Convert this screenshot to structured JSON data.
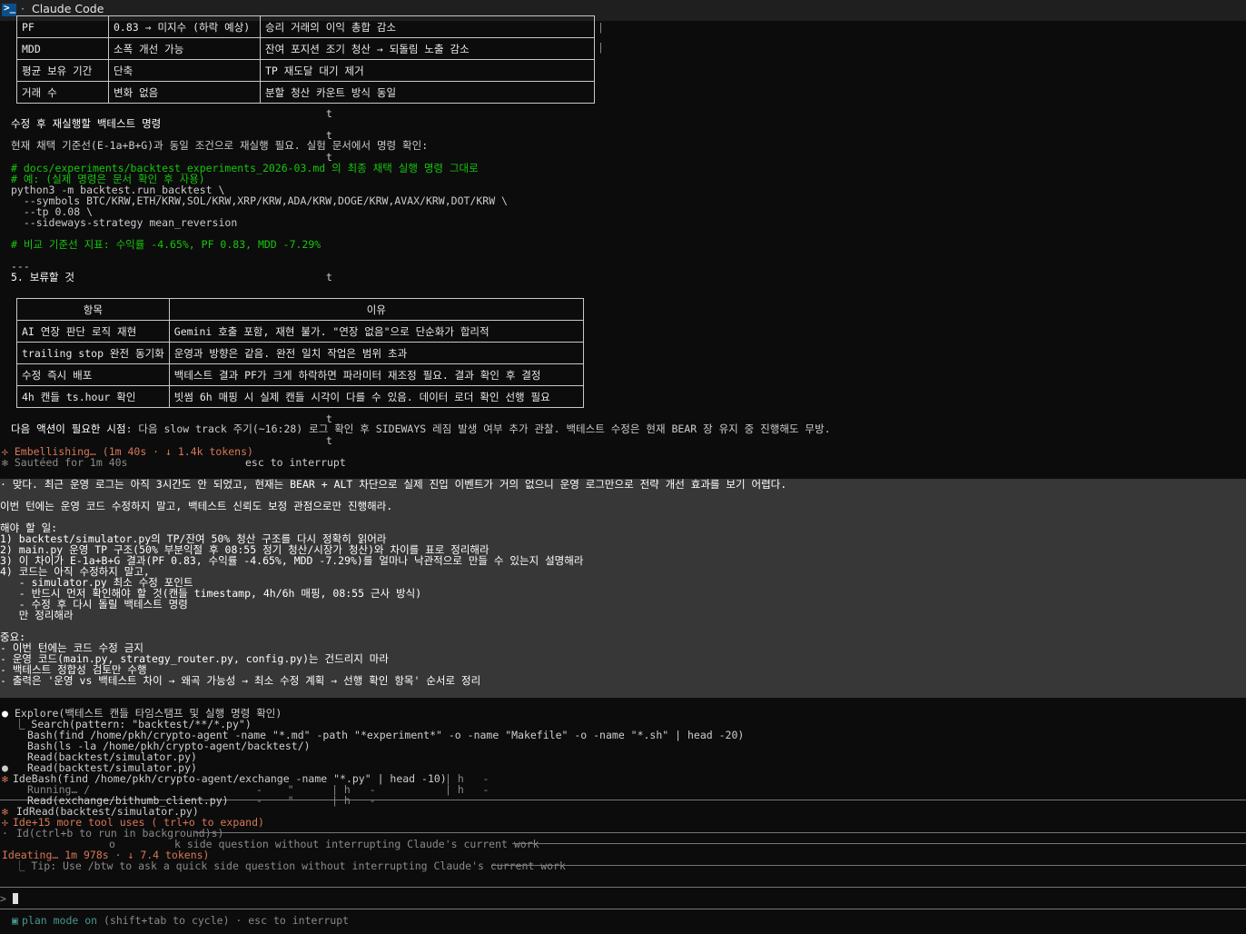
{
  "window": {
    "title": "Claude Code",
    "app_icon": "terminal-icon"
  },
  "top_table": {
    "rows": [
      [
        "PF",
        "0.83 → 미지수 (하락 예상)",
        "승리 거래의 이익 총합 감소"
      ],
      [
        "MDD",
        "소폭 개선 가능",
        "잔여 포지션 조기 청산 → 되돌림 노출 감소"
      ],
      [
        "평균 보유 기간",
        "단축",
        "TP 재도달 대기 제거"
      ],
      [
        "거래 수",
        "변화 없음",
        "분할 청산 카운트 방식 동일"
      ]
    ]
  },
  "stray_marks": {
    "t": "t"
  },
  "section_rerun": {
    "heading": "수정 후 재실행할 백테스트 명령",
    "desc": "현재 채택 기준선(E-1a+B+G)과 동일 조건으로 재실행 필요. 실험 문서에서 명령 확인:",
    "code_comment1": "# docs/experiments/backtest_experiments_2026-03.md 의 최종 채택 실행 명령 그대로",
    "code_comment2": "# 예: (실제 명령은 문서 확인 후 사용)",
    "code_line1": "python3 -m backtest.run_backtest \\",
    "code_line2": "  --symbols BTC/KRW,ETH/KRW,SOL/KRW,XRP/KRW,ADA/KRW,DOGE/KRW,AVAX/KRW,DOT/KRW \\",
    "code_line3": "  --tp 0.08 \\",
    "code_line4": "  --sideways-strategy mean_reversion",
    "code_comment3": "# 비교 기준선 지표: 수익률 -4.65%, PF 0.83, MDD -7.29%",
    "separator": "---"
  },
  "section_defer": {
    "heading": "5. 보류할 것",
    "header": [
      "항목",
      "이유"
    ],
    "rows": [
      [
        "AI 연장 판단 로직 재현",
        "Gemini 호출 포함, 재현 불가. \"연장 없음\"으로 단순화가 합리적"
      ],
      [
        "trailing stop 완전 동기화",
        "운영과 방향은 같음. 완전 일치 작업은 범위 초과"
      ],
      [
        "수정 즉시 배포",
        "백테스트 결과 PF가 크게 하락하면 파라미터 재조정 필요. 결과 확인 후 결정"
      ],
      [
        "4h 캔들 ts.hour 확인",
        "빗썸 6h 매핑 시 실제 캔들 시각이 다를 수 있음. 데이터 로더 확인 선행 필요"
      ]
    ]
  },
  "next_action": {
    "label": "다음 액션이 필요한 시점",
    "text": ": 다음 slow track 주기(~16:28) 로그 확인 후 SIDEWAYS 레짐 발생 여부 추가 관찰. 백테스트 수정은 현재 BEAR 장 유지 중 진행해도 무방."
  },
  "status_lines": {
    "embellishing": "✢ Embellishing… (1m 40s · ↓ 1.4k tokens)",
    "esc": "esc to interrupt",
    "sauteed": "✻ Sautéed for 1m 40s"
  },
  "user_prompt": {
    "lines": [
      "· 맞다. 최근 운영 로그는 아직 3시간도 안 되었고, 현재는 BEAR + ALT 차단으로 실제 진입 이벤트가 거의 없으니 운영 로그만으로 전략 개선 효과를 보기 어렵다.",
      "",
      "이번 턴에는 운영 코드 수정하지 말고, 백테스트 신뢰도 보정 관점으로만 진행해라.",
      "",
      "해야 할 일:",
      "1) backtest/simulator.py의 TP/잔여 50% 청산 구조를 다시 정확히 읽어라",
      "2) main.py 운영 TP 구조(50% 부분익절 후 08:55 정기 청산/시장가 청산)와 차이를 표로 정리해라",
      "3) 이 차이가 E-1a+B+G 결과(PF 0.83, 수익률 -4.65%, MDD -7.29%)를 얼마나 낙관적으로 만들 수 있는지 설명해라",
      "4) 코드는 아직 수정하지 말고,",
      "   - simulator.py 최소 수정 포인트",
      "   - 반드시 먼저 확인해야 할 것(캔들 timestamp, 4h/6h 매핑, 08:55 근사 방식)",
      "   - 수정 후 다시 돌릴 백테스트 명령",
      "   만 정리해라",
      "",
      "중요:",
      "- 이번 턴에는 코드 수정 금지",
      "- 운영 코드(main.py, strategy_router.py, config.py)는 건드리지 마라",
      "- 백테스트 정합성 검토만 수행",
      "- 출력은 '운영 vs 백테스트 차이 → 왜곡 가능성 → 최소 수정 계획 → 선행 확인 항목' 순서로 정리"
    ]
  },
  "tool_log": {
    "explore": "Explore(백테스트 캔들 타임스탬프 및 실행 명령 확인)",
    "search": "⎿ Search(pattern: \"backtest/**/*.py\")",
    "bash1": "Bash(find /home/pkh/crypto-agent -name \"*.md\" -path \"*experiment*\" -o -name \"Makefile\" -o -name \"*.sh\" | head -20)",
    "bash2": "Bash(ls -la /home/pkh/crypto-agent/backtest/)",
    "read1": "Read(backtest/simulator.py)",
    "read2": "Read(backtest/simulator.py)",
    "ide_bash": "IdeBash(find /home/pkh/crypto-agent/exchange -name \"*.py\" | head -10)",
    "running": "Running… /",
    "read3": "Read(exchange/bithumb_client.py)",
    "ide_read": "IdRead(backtest/simulator.py)",
    "more_uses": "Ide+15 more tool uses ( trl+o to expand)",
    "ctrl_b": "Id(ctrl+b to run in background)s)",
    "side_question": "k side question without interrupting Claude's current work",
    "ideating": "Ideating… 1m 978s · ↓ 7.4 tokens)",
    "tip": "⎿ Tip: Use /btw to ask a quick side question without interrupting Claude's current work"
  },
  "input": {
    "prompt_symbol": ">",
    "value": ""
  },
  "footer": {
    "mode": "plan mode on",
    "hint": " (shift+tab to cycle) · esc to interrupt"
  }
}
